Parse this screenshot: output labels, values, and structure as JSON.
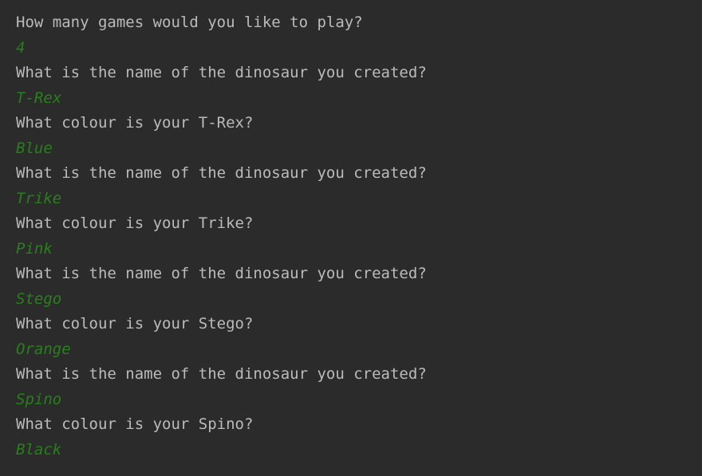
{
  "console": {
    "lines": [
      {
        "kind": "output",
        "text": "How many games would you like to play?"
      },
      {
        "kind": "input",
        "text": "4"
      },
      {
        "kind": "output",
        "text": "What is the name of the dinosaur you created?"
      },
      {
        "kind": "input",
        "text": "T-Rex"
      },
      {
        "kind": "output",
        "text": "What colour is your T-Rex?"
      },
      {
        "kind": "input",
        "text": "Blue"
      },
      {
        "kind": "output",
        "text": "What is the name of the dinosaur you created?"
      },
      {
        "kind": "input",
        "text": "Trike"
      },
      {
        "kind": "output",
        "text": "What colour is your Trike?"
      },
      {
        "kind": "input",
        "text": "Pink"
      },
      {
        "kind": "output",
        "text": "What is the name of the dinosaur you created?"
      },
      {
        "kind": "input",
        "text": "Stego"
      },
      {
        "kind": "output",
        "text": "What colour is your Stego?"
      },
      {
        "kind": "input",
        "text": "Orange"
      },
      {
        "kind": "output",
        "text": "What is the name of the dinosaur you created?"
      },
      {
        "kind": "input",
        "text": "Spino"
      },
      {
        "kind": "output",
        "text": "What colour is your Spino?"
      },
      {
        "kind": "input",
        "text": "Black"
      }
    ]
  },
  "colors": {
    "background": "#2b2b2b",
    "output_text": "#bbbbbb",
    "user_input_text": "#287f1c"
  }
}
